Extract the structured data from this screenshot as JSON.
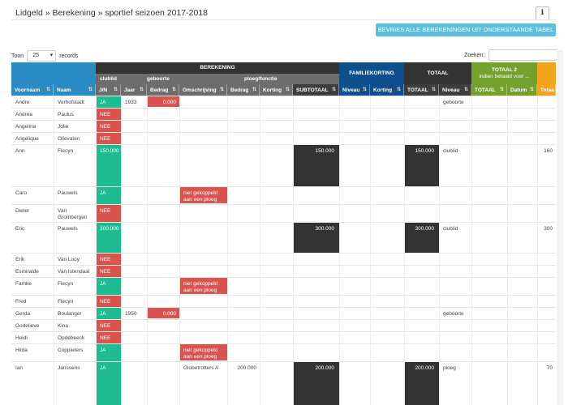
{
  "header": {
    "breadcrumb": "Lidgeld » Berekening » sportief seizoen 2017-2018",
    "info_label": "i",
    "freeze_button": "BEVRIES ALLE BEREKENINGEN UIT ONDERSTAANDE TABEL ❄"
  },
  "controls": {
    "show_label": "Toon",
    "show_value": "25",
    "records_label": "records",
    "search_label": "Zoeken:"
  },
  "groups": {
    "berekening": "BEREKENING",
    "clublid": "clublid",
    "geboorte": "geboorte",
    "ploeg": "ploeg/functie",
    "familiekorting": "FAMILIEKORTING",
    "totaal": "TOTAAL",
    "totaal2_line1": "TOTAAL 2",
    "totaal2_line2": "indien betaald voor ..."
  },
  "columns": [
    {
      "key": "voornaam",
      "label": "Voornaam"
    },
    {
      "key": "naam",
      "label": "Naam"
    },
    {
      "key": "jn",
      "label": "J/N"
    },
    {
      "key": "jaar",
      "label": "Jaar"
    },
    {
      "key": "bedrag",
      "label": "Bedrag"
    },
    {
      "key": "omschrijving",
      "label": "Omschrijving"
    },
    {
      "key": "bedrag2",
      "label": "Bedrag"
    },
    {
      "key": "korting",
      "label": "Korting"
    },
    {
      "key": "subtotaal",
      "label": "SUBTOTAAL"
    },
    {
      "key": "niveau",
      "label": "Niveau"
    },
    {
      "key": "korting2",
      "label": "Korting"
    },
    {
      "key": "totaal",
      "label": "TOTAAL"
    },
    {
      "key": "niveau2",
      "label": "Niveau"
    },
    {
      "key": "totaal2",
      "label": "TOTAAL"
    },
    {
      "key": "datum",
      "label": "Datum"
    },
    {
      "key": "totaal3",
      "label": "Totaa"
    }
  ],
  "rows": [
    {
      "voornaam": "Andre",
      "naam": "Verhofstadt",
      "jn": "JA",
      "jaar": "1933",
      "bedrag": "0.000",
      "niveau2": "geboorte"
    },
    {
      "voornaam": "Andrea",
      "naam": "Paulus",
      "jn": "NEE"
    },
    {
      "voornaam": "Angelina",
      "naam": "Jolie",
      "jn": "NEE"
    },
    {
      "voornaam": "Angelique",
      "naam": "Olievaten",
      "jn": "NEE"
    },
    {
      "voornaam": "Ann",
      "naam": "Flecyn",
      "jn": "150.000",
      "subtotaal": "150.000",
      "totaal": "150.000",
      "niveau2": "clublid",
      "totaal3": "160"
    },
    {
      "voornaam": "Caro",
      "naam": "Pauwels",
      "jn": "JA",
      "omschrijving": "niet gekoppeld aan een ploeg"
    },
    {
      "voornaam": "Dieter",
      "naam": "Van Grombergen",
      "jn": "NEE"
    },
    {
      "voornaam": "Eric",
      "naam": "Pauwels",
      "jn": "300.000",
      "subtotaal": "300.000",
      "totaal": "300.000",
      "niveau2": "clublid",
      "totaal3": "300"
    },
    {
      "voornaam": "Erik",
      "naam": "Van Looy",
      "jn": "NEE"
    },
    {
      "voornaam": "Esmiralde",
      "naam": "Van Istendaal",
      "jn": "NEE"
    },
    {
      "voornaam": "Famke",
      "naam": "Flecyn",
      "jn": "JA",
      "omschrijving": "niet gekoppeld aan een ploeg"
    },
    {
      "voornaam": "Fred",
      "naam": "Flecyn",
      "jn": "NEE"
    },
    {
      "voornaam": "Gerda",
      "naam": "Boulanger",
      "jn": "JA",
      "jaar": "1950",
      "bedrag": "0.000",
      "niveau2": "geboorte"
    },
    {
      "voornaam": "Godelieve",
      "naam": "Kina",
      "jn": "NEE"
    },
    {
      "voornaam": "Heidi",
      "naam": "Opdebeeck",
      "jn": "NEE"
    },
    {
      "voornaam": "Hilda",
      "naam": "Coppieters",
      "jn": "JA",
      "omschrijving": "niet gekoppeld aan een ploeg"
    },
    {
      "voornaam": "Ian",
      "naam": "Janssens",
      "jn": "JA",
      "omschrijving": "Globetrotters A",
      "bedrag2": "200.000",
      "subtotaal": "200.000",
      "totaal": "200.000",
      "niveau2": "ploeg",
      "totaal3": "70"
    }
  ]
}
